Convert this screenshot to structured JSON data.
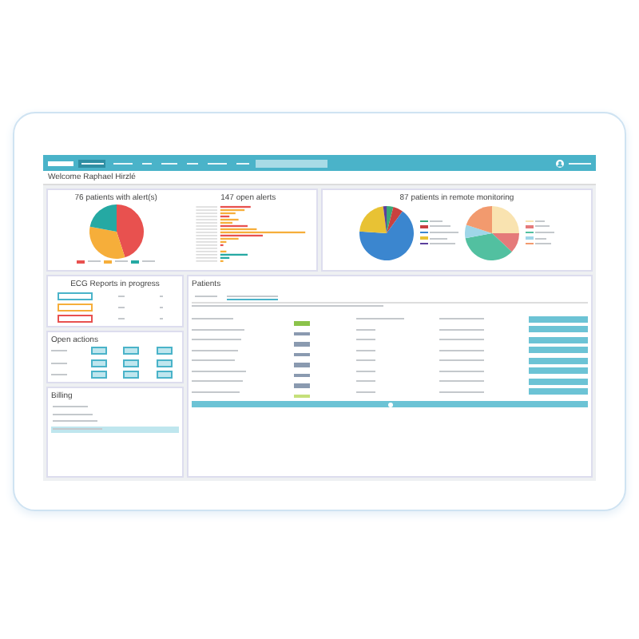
{
  "nav": {
    "items": [
      {
        "selected": true
      },
      {
        "selected": false
      },
      {
        "selected": false
      },
      {
        "selected": false
      },
      {
        "selected": false
      },
      {
        "selected": false
      },
      {
        "selected": false
      }
    ]
  },
  "welcome": "Welcome Raphael Hirzlé",
  "alerts_card": {
    "pie_title": "76 patients with alert(s)",
    "legend": [
      {
        "color": "#e8514f"
      },
      {
        "color": "#f6ae3a"
      },
      {
        "color": "#25a9a3"
      }
    ],
    "bar_title": "147 open alerts"
  },
  "monitoring_card": {
    "title": "87 patients in remote monitoring",
    "legend_a": [
      {
        "color": "#3aa87a"
      },
      {
        "color": "#c8413f"
      },
      {
        "color": "#3b86cf"
      },
      {
        "color": "#e8c234"
      },
      {
        "color": "#5b3f9c"
      }
    ],
    "legend_b": [
      {
        "color": "#f9e3b0"
      },
      {
        "color": "#e57a7a"
      },
      {
        "color": "#52c0a0"
      },
      {
        "color": "#9fd6e8"
      },
      {
        "color": "#f29a6e"
      }
    ]
  },
  "ecg": {
    "title": "ECG Reports in progress",
    "rows": [
      {
        "color": "#4ab3c9"
      },
      {
        "color": "#f6ae3a"
      },
      {
        "color": "#e8514f"
      }
    ]
  },
  "actions": {
    "title": "Open actions"
  },
  "billing": {
    "title": "Billing",
    "lines": [
      {
        "selected": false
      },
      {
        "selected": false
      },
      {
        "selected": false
      },
      {
        "selected": true
      }
    ]
  },
  "patients": {
    "title": "Patients",
    "tabs": [
      {
        "selected": false
      },
      {
        "selected": true
      }
    ],
    "rows": [
      {
        "color": "#8bc34a"
      },
      {
        "color": "#8a9ab0"
      },
      {
        "color": "#8a9ab0"
      },
      {
        "color": "#8a9ab0"
      },
      {
        "color": "#8a9ab0"
      },
      {
        "color": "#8a9ab0"
      },
      {
        "color": "#8a9ab0"
      },
      {
        "color": "#c5e07a"
      }
    ]
  }
}
